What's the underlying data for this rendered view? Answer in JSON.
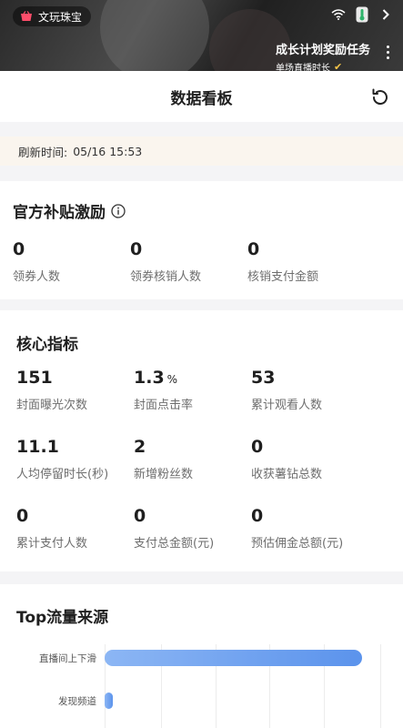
{
  "top_bar": {
    "shop_label": "文玩珠宝",
    "task_title": "成长计划奖励任务",
    "task_sub": "单场直播时长",
    "task_check": "✔"
  },
  "header": {
    "title": "数据看板"
  },
  "refresh": {
    "label": "刷新时间:",
    "time": "05/16 15:53"
  },
  "subsidy": {
    "title": "官方补贴激励",
    "metrics": [
      {
        "value": "0",
        "label": "领券人数"
      },
      {
        "value": "0",
        "label": "领券核销人数"
      },
      {
        "value": "0",
        "label": "核销支付金额"
      }
    ]
  },
  "core": {
    "title": "核心指标",
    "metrics": [
      {
        "value": "151",
        "unit": "",
        "label": "封面曝光次数"
      },
      {
        "value": "1.3",
        "unit": "%",
        "label": "封面点击率"
      },
      {
        "value": "53",
        "unit": "",
        "label": "累计观看人数"
      },
      {
        "value": "11.1",
        "unit": "",
        "label": "人均停留时长(秒)"
      },
      {
        "value": "2",
        "unit": "",
        "label": "新增粉丝数"
      },
      {
        "value": "0",
        "unit": "",
        "label": "收获薯钻总数"
      },
      {
        "value": "0",
        "unit": "",
        "label": "累计支付人数"
      },
      {
        "value": "0",
        "unit": "",
        "label": "支付总金额(元)"
      },
      {
        "value": "0",
        "unit": "",
        "label": "预估佣金总额(元)"
      }
    ]
  },
  "traffic": {
    "title": "Top流量来源"
  },
  "chart_data": {
    "type": "bar",
    "orientation": "horizontal",
    "categories": [
      "直播间上下滑",
      "发现频道"
    ],
    "values": [
      100,
      3
    ],
    "xlim": [
      0,
      100
    ],
    "grid": true,
    "color": "#6a9ff0"
  }
}
